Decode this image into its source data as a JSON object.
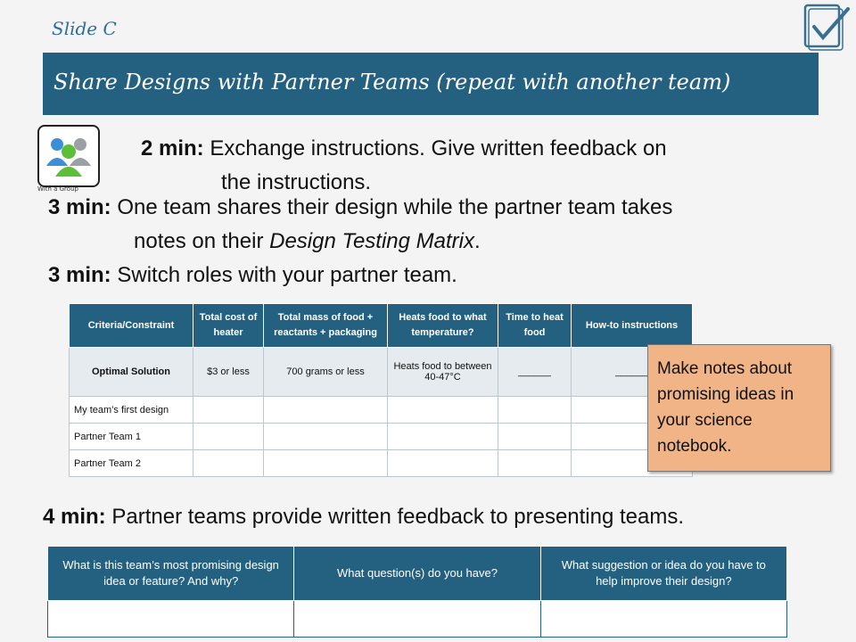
{
  "slide_label": "Slide C",
  "title": "Share Designs with Partner Teams (repeat with another team)",
  "group_caption": "With a Group",
  "steps": [
    {
      "time": "2 min:",
      "text": "Exchange instructions. Give written feedback on",
      "cont": "the instructions."
    },
    {
      "time": "3 min:",
      "text": "One team shares their design while the partner team takes",
      "cont_prefix": "notes on their ",
      "cont_em": "Design Testing Matrix",
      "cont_suffix": "."
    },
    {
      "time": "3 min:",
      "text": "Switch roles with your partner team."
    },
    {
      "time": "4 min:",
      "text": "Partner teams provide written feedback to presenting teams."
    }
  ],
  "matrix": {
    "headers": [
      "Criteria/Constraint",
      "Total cost of heater",
      "Total mass of food + reactants + packaging",
      "Heats food to what temperature?",
      "Time to heat food",
      "How-to instructions"
    ],
    "optimal": [
      "Optimal Solution",
      "$3 or less",
      "700 grams or less",
      "Heats food to between 40-47°C",
      "______",
      "______"
    ],
    "rows": [
      "My team’s first design",
      "Partner Team 1",
      "Partner Team 2"
    ]
  },
  "note": "Make notes about promising ideas in your science notebook.",
  "feedback_headers": [
    "What is this team’s most promising design idea or feature? And why?",
    "What question(s) do you have?",
    "What suggestion or idea do you have to help improve their design?"
  ],
  "colors": {
    "accent": "#24607f",
    "note_bg": "#f0b487",
    "label": "#2e6e99"
  }
}
